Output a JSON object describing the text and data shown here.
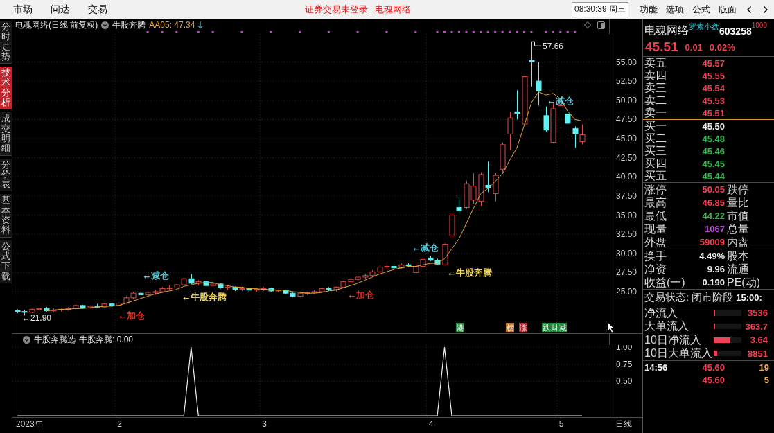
{
  "top_bar": {
    "menus": [
      "市场",
      "问达",
      "交易"
    ],
    "notice": "证券交易未登录",
    "notice_stock": "电魂网络",
    "clock": "08:30:39 周三",
    "actions": [
      "功能",
      "选项",
      "公式",
      "版面"
    ]
  },
  "side_tabs": [
    {
      "label": "分时走势",
      "selected": false
    },
    {
      "label": "技术分析",
      "selected": true
    },
    {
      "label": "成交明细",
      "selected": false
    },
    {
      "label": "分价表",
      "selected": false
    },
    {
      "label": "基本资料",
      "selected": false
    },
    {
      "label": "公式下载",
      "selected": false
    }
  ],
  "main_chart": {
    "title": "电魂网络(日线 前复权)",
    "indicator": "牛股奔腾",
    "reading": "AA05: 47.34",
    "signal_labels": [
      {
        "text": "←加仓",
        "color": "#ff3b30"
      },
      {
        "text": "←减仓",
        "color": "#5fd8e8"
      },
      {
        "text": "←牛股奔腾",
        "color": "#ffe46a"
      },
      {
        "text": "←加仓",
        "color": "#ff3b30"
      },
      {
        "text": "←减仓",
        "color": "#5fd8e8"
      },
      {
        "text": "←牛股奔腾",
        "color": "#ffe46a"
      },
      {
        "text": "←减仓",
        "color": "#5fd8e8"
      }
    ],
    "event_marks": [
      {
        "text": "港",
        "color": "#228b3b"
      },
      {
        "text": "榜",
        "color": "#b8732e"
      },
      {
        "text": "涨",
        "color": "#a8262e"
      },
      {
        "text": "跌",
        "color": "#228b3b"
      },
      {
        "text": "财",
        "color": "#228b3b"
      },
      {
        "text": "减",
        "color": "#228b3b"
      }
    ],
    "chart_data": [
      {
        "type": "candlestick",
        "grid": true,
        "ylim": [
          19.66,
          58.67
        ],
        "yticks": [
          {
            "value": 25,
            "label": "25.00"
          },
          {
            "value": 27.5,
            "label": "27.50"
          },
          {
            "value": 30,
            "label": "30.00"
          },
          {
            "value": 32.5,
            "label": "32.50"
          },
          {
            "value": 35,
            "label": "35.00"
          },
          {
            "value": 37.5,
            "label": "37.50"
          },
          {
            "value": 40,
            "label": "40.00"
          },
          {
            "value": 42.5,
            "label": "42.50"
          },
          {
            "value": 45,
            "label": "45.00"
          },
          {
            "value": 47.5,
            "label": "47.50"
          },
          {
            "value": 50,
            "label": "50.00"
          },
          {
            "value": 52.5,
            "label": "52.50"
          },
          {
            "value": 55,
            "label": "55.00"
          }
        ],
        "annotations": [
          "←21.90",
          "57.66"
        ],
        "ohlc": [
          [
            22.5,
            22.7,
            22.2,
            22.4
          ],
          [
            22.4,
            22.6,
            21.9,
            22.3
          ],
          [
            22.3,
            22.8,
            22.2,
            22.7
          ],
          [
            22.7,
            22.9,
            22.5,
            22.8
          ],
          [
            22.8,
            23.0,
            22.4,
            22.5
          ],
          [
            22.5,
            22.8,
            22.3,
            22.6
          ],
          [
            22.6,
            22.8,
            22.4,
            22.7
          ],
          [
            22.7,
            23.0,
            22.5,
            22.8
          ],
          [
            22.8,
            23.4,
            22.7,
            23.2
          ],
          [
            23.2,
            23.3,
            22.8,
            22.9
          ],
          [
            22.9,
            23.2,
            22.8,
            23.1
          ],
          [
            23.1,
            23.4,
            22.9,
            23.0
          ],
          [
            23.0,
            23.5,
            22.9,
            23.4
          ],
          [
            23.4,
            23.5,
            23.0,
            23.2
          ],
          [
            23.2,
            23.6,
            23.1,
            23.5
          ],
          [
            23.5,
            24.4,
            23.4,
            24.2
          ],
          [
            24.2,
            25.0,
            24.0,
            24.8
          ],
          [
            24.8,
            25.1,
            24.4,
            24.6
          ],
          [
            24.6,
            25.0,
            24.4,
            24.9
          ],
          [
            24.9,
            25.2,
            24.6,
            25.0
          ],
          [
            25.0,
            25.6,
            24.9,
            25.4
          ],
          [
            25.4,
            25.8,
            25.2,
            25.5
          ],
          [
            25.5,
            26.0,
            25.3,
            25.9
          ],
          [
            25.9,
            26.9,
            25.8,
            26.7
          ],
          [
            26.7,
            27.3,
            26.0,
            26.1
          ],
          [
            26.1,
            26.5,
            25.8,
            26.3
          ],
          [
            26.3,
            26.4,
            25.7,
            25.8
          ],
          [
            25.8,
            26.2,
            25.6,
            26.0
          ],
          [
            26.0,
            26.1,
            25.4,
            25.5
          ],
          [
            25.5,
            25.8,
            25.2,
            25.6
          ],
          [
            25.6,
            25.7,
            25.1,
            25.3
          ],
          [
            25.3,
            25.6,
            25.1,
            25.4
          ],
          [
            25.4,
            25.5,
            25.0,
            25.2
          ],
          [
            25.2,
            25.5,
            25.0,
            25.3
          ],
          [
            25.3,
            25.6,
            25.1,
            25.4
          ],
          [
            25.4,
            25.5,
            25.0,
            25.1
          ],
          [
            25.1,
            25.3,
            24.9,
            25.2
          ],
          [
            25.2,
            25.3,
            24.7,
            24.8
          ],
          [
            24.8,
            25.0,
            24.3,
            24.4
          ],
          [
            24.4,
            24.9,
            24.3,
            24.8
          ],
          [
            24.8,
            25.0,
            24.6,
            24.9
          ],
          [
            24.9,
            25.2,
            24.7,
            25.0
          ],
          [
            25.0,
            25.5,
            24.9,
            25.4
          ],
          [
            25.4,
            25.6,
            25.1,
            25.3
          ],
          [
            25.3,
            25.7,
            25.0,
            25.6
          ],
          [
            25.6,
            26.4,
            25.5,
            26.3
          ],
          [
            26.3,
            26.8,
            26.1,
            26.6
          ],
          [
            26.6,
            27.1,
            26.4,
            26.9
          ],
          [
            26.9,
            27.3,
            26.7,
            27.1
          ],
          [
            27.1,
            27.8,
            27.0,
            27.6
          ],
          [
            27.6,
            28.4,
            27.5,
            28.2
          ],
          [
            28.2,
            28.5,
            27.9,
            28.3
          ],
          [
            28.3,
            28.6,
            28.0,
            28.1
          ],
          [
            28.1,
            28.7,
            28.0,
            28.5
          ],
          [
            28.5,
            28.7,
            28.2,
            28.4
          ],
          [
            27.5,
            28.6,
            27.4,
            28.3
          ],
          [
            28.3,
            29.5,
            28.2,
            29.2
          ],
          [
            29.4,
            29.7,
            29.0,
            29.1
          ],
          [
            29.1,
            29.3,
            28.5,
            28.6
          ],
          [
            28.5,
            31.3,
            28.4,
            31.2
          ],
          [
            32.3,
            35.3,
            32.0,
            35.0
          ],
          [
            36.0,
            37.3,
            35.2,
            35.6
          ],
          [
            36.0,
            39.5,
            35.8,
            39.1
          ],
          [
            37.0,
            40.5,
            36.5,
            38.8
          ],
          [
            36.8,
            40.6,
            36.2,
            40.3
          ],
          [
            38.9,
            42.0,
            38.0,
            38.6
          ],
          [
            37.8,
            40.5,
            36.8,
            40.2
          ],
          [
            41.0,
            44.5,
            40.5,
            44.2
          ],
          [
            45.6,
            48.5,
            43.5,
            47.7
          ],
          [
            48.5,
            51.3,
            47.5,
            48.3
          ],
          [
            46.9,
            53.1,
            46.9,
            53.1
          ],
          [
            55.2,
            57.66,
            51.8,
            55.0
          ],
          [
            52.5,
            55.0,
            49.3,
            51.2
          ],
          [
            48.0,
            49.2,
            45.9,
            46.1
          ],
          [
            44.5,
            49.6,
            44.4,
            48.9
          ],
          [
            49.3,
            51.3,
            46.4,
            49.8
          ],
          [
            48.2,
            48.4,
            45.3,
            47.0
          ],
          [
            46.3,
            46.6,
            43.8,
            45.6
          ],
          [
            44.6,
            46.85,
            44.22,
            45.51
          ]
        ],
        "series": [
          {
            "type": "line",
            "color": "#e0a838",
            "values": [
              null,
              null,
              null,
              null,
              22.5,
              22.6,
              22.7,
              22.7,
              22.8,
              22.8,
              22.9,
              23.0,
              23.1,
              23.1,
              23.2,
              23.5,
              23.8,
              24.1,
              24.4,
              24.7,
              24.9,
              25.1,
              25.3,
              25.7,
              25.9,
              26.1,
              26.2,
              26.2,
              25.9,
              25.8,
              25.6,
              25.6,
              25.4,
              25.4,
              25.3,
              25.3,
              25.2,
              25.2,
              25.0,
              24.9,
              24.8,
              24.8,
              24.9,
              25.1,
              25.2,
              25.5,
              25.8,
              26.1,
              26.5,
              26.9,
              27.3,
              27.6,
              27.9,
              28.1,
              28.3,
              28.3,
              28.5,
              28.7,
              28.7,
              29.3,
              30.6,
              31.9,
              33.9,
              35.9,
              37.8,
              38.5,
              39.4,
              40.4,
              42.2,
              43.8,
              46.7,
              49.7,
              51.1,
              50.7,
              50.9,
              50.2,
              48.6,
              47.5,
              47.3
            ]
          }
        ]
      }
    ]
  },
  "sub_chart": {
    "title": "牛股奔腾选",
    "reading": "牛股奔腾: 0.00",
    "chart_data": [
      {
        "type": "line",
        "grid": true,
        "color": "#f2f2f2",
        "ylim": [
          -0.02,
          1.03
        ],
        "yticks": [
          {
            "value": 0.5,
            "label": "0.50"
          },
          {
            "value": 0.75,
            "label": "0.75"
          },
          {
            "value": 1,
            "label": "1.00"
          }
        ],
        "values": [
          0,
          0,
          0,
          0,
          0,
          0,
          0,
          0,
          0,
          0,
          0,
          0,
          0,
          0,
          0,
          0,
          0,
          0,
          0,
          0,
          0,
          0,
          0,
          0,
          1,
          0,
          0,
          0,
          0,
          0,
          0,
          0,
          0,
          0,
          0,
          0,
          0,
          0,
          0,
          0,
          0,
          0,
          0,
          0,
          0,
          0,
          0,
          0,
          0,
          0,
          0,
          0,
          0,
          0,
          0,
          0,
          0,
          0,
          0,
          1,
          0,
          0,
          0,
          0,
          0,
          0,
          0,
          0,
          0,
          0,
          0,
          0,
          0,
          0,
          0,
          0,
          0,
          0,
          0
        ]
      }
    ]
  },
  "date_axis": {
    "labels": [
      "2023年",
      "2",
      "3",
      "4",
      "5"
    ],
    "period": "日线"
  },
  "quote_panel": {
    "name": "电魂网络",
    "tag": "罗素小盘",
    "code": "603258",
    "index_tag": "1000",
    "price": "45.51",
    "change": "0.01",
    "change_pct": "0.02%",
    "order_book": [
      {
        "kind": "ask",
        "label": "卖五",
        "price": "45.57",
        "color": "#f0404f"
      },
      {
        "kind": "ask",
        "label": "卖四",
        "price": "45.55",
        "color": "#f0404f"
      },
      {
        "kind": "ask",
        "label": "卖三",
        "price": "45.54",
        "color": "#f0404f"
      },
      {
        "kind": "ask",
        "label": "卖二",
        "price": "45.53",
        "color": "#f0404f"
      },
      {
        "kind": "ask",
        "label": "卖一",
        "price": "45.51",
        "color": "#f0404f"
      },
      {
        "kind": "bid",
        "label": "买一",
        "price": "45.50",
        "color": "#ececec"
      },
      {
        "kind": "bid",
        "label": "买二",
        "price": "45.48",
        "color": "#35b54a"
      },
      {
        "kind": "bid",
        "label": "买三",
        "price": "45.46",
        "color": "#35b54a"
      },
      {
        "kind": "bid",
        "label": "买四",
        "price": "45.45",
        "color": "#35b54a"
      },
      {
        "kind": "bid",
        "label": "买五",
        "price": "45.44",
        "color": "#35b54a"
      }
    ],
    "stats": [
      {
        "label": "涨停",
        "value": "50.05",
        "color": "#f0404f",
        "label_2": "跌停"
      },
      {
        "label": "最高",
        "value": "46.85",
        "color": "#f0404f",
        "label_2": "量比"
      },
      {
        "label": "最低",
        "value": "44.22",
        "color": "#35b54a",
        "label_2": "市值"
      },
      {
        "label": "现量",
        "value": "1067",
        "color": "#c24fe0",
        "label_2": "总量"
      },
      {
        "label": "外盘",
        "value": "59009",
        "color": "#f0404f",
        "label_2": "内盘"
      }
    ],
    "fundamentals": [
      {
        "label": "换手",
        "value": "4.49%",
        "label_2": "股本"
      },
      {
        "label": "净资",
        "value": "9.96",
        "label_2": "流通"
      },
      {
        "label": "收益(一)",
        "value": "0.190",
        "label_2": "PE(动)"
      }
    ],
    "trade_status": {
      "label": "交易状态:",
      "value": "闭市阶段",
      "time": "15:00:"
    },
    "flows": [
      {
        "label": "净流入",
        "level": 0.05,
        "value": "3536"
      },
      {
        "label": "大单流入",
        "level": 0.05,
        "value": "363.7"
      },
      {
        "label": "10日净流入",
        "level": 0.6,
        "value": "3.64"
      },
      {
        "label": "10日大单流入",
        "level": 0.13,
        "value": "8851"
      }
    ],
    "ticks": [
      {
        "time": "14:56",
        "price": "45.60",
        "volume": "19"
      },
      {
        "price": "45.60",
        "volume": "5"
      }
    ]
  }
}
